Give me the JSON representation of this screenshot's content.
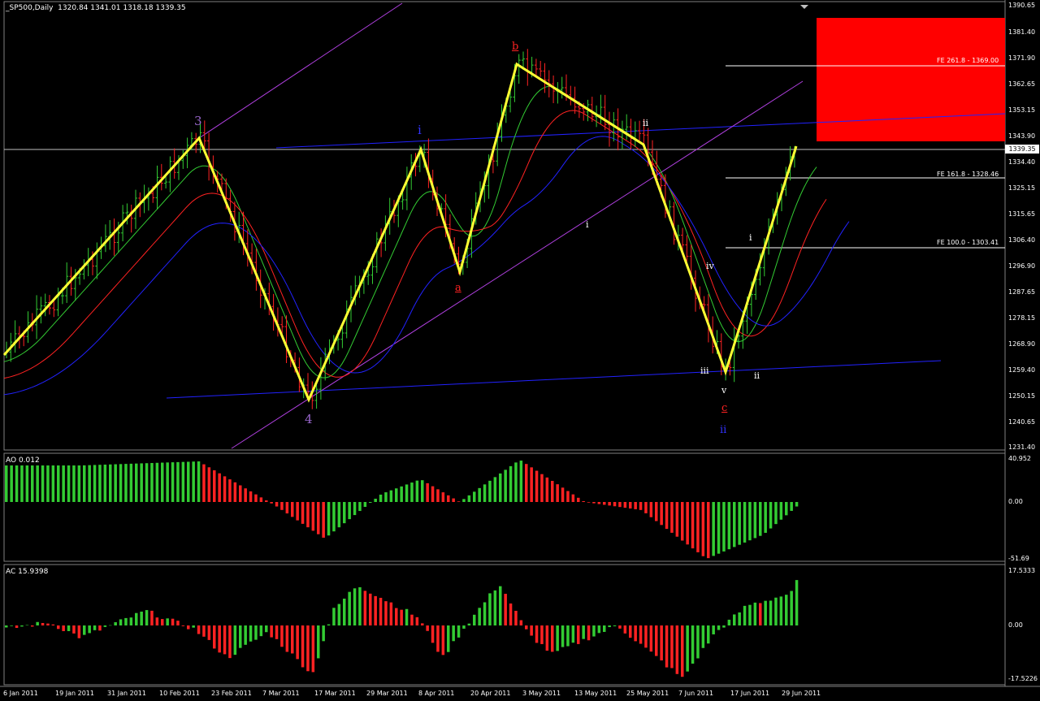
{
  "header": {
    "symbol_line": "_SP500,Daily  1320.84 1341.01 1318.18 1339.35"
  },
  "price_scale": [
    "1390.65",
    "1381.40",
    "1371.90",
    "1362.65",
    "1353.15",
    "1343.90",
    "1334.40",
    "1325.15",
    "1315.65",
    "1306.40",
    "1296.90",
    "1287.65",
    "1278.15",
    "1268.90",
    "1259.40",
    "1250.15",
    "1240.65",
    "1231.40"
  ],
  "last_price": "1339.35",
  "fe_levels": [
    {
      "label": "FE 261.8 - 1369.00"
    },
    {
      "label": "FE 161.8 - 1328.46"
    },
    {
      "label": "FE 100.0 - 1303.41"
    }
  ],
  "wave_labels": [
    {
      "text": "3",
      "color": "#9966cc"
    },
    {
      "text": "4",
      "color": "#9966cc"
    },
    {
      "text": "i",
      "color": "#3333ff"
    },
    {
      "text": "a",
      "color": "#ff2222"
    },
    {
      "text": "b",
      "color": "#ff2222"
    },
    {
      "text": "ii",
      "color": "#ffffff"
    },
    {
      "text": "i",
      "color": "#ffffff"
    },
    {
      "text": "iv",
      "color": "#ffffff"
    },
    {
      "text": "i",
      "color": "#ffffff"
    },
    {
      "text": "iii",
      "color": "#ffffff"
    },
    {
      "text": "ii",
      "color": "#ffffff"
    },
    {
      "text": "v",
      "color": "#ffffff"
    },
    {
      "text": "c",
      "color": "#ff2222"
    },
    {
      "text": "ii",
      "color": "#3333ff"
    }
  ],
  "ao_pane": {
    "title": "AO 0.012",
    "scale": [
      "40.952",
      "0.00",
      "-51.69"
    ]
  },
  "ac_pane": {
    "title": "AC 15.9398",
    "scale": [
      "17.5333",
      "0.00",
      "-17.5226"
    ]
  },
  "dates": [
    "6 Jan 2011",
    "19 Jan 2011",
    "31 Jan 2011",
    "10 Feb 2011",
    "23 Feb 2011",
    "7 Mar 2011",
    "17 Mar 2011",
    "29 Mar 2011",
    "8 Apr 2011",
    "20 Apr 2011",
    "3 May 2011",
    "13 May 2011",
    "25 May 2011",
    "7 Jun 2011",
    "17 Jun 2011",
    "29 Jun 2011"
  ],
  "colors": {
    "background": "#000000",
    "bull_bar": "#33cc33",
    "bear_bar": "#ff2222",
    "zigzag": "#ffff33",
    "trend_blue": "#2222ff",
    "trend_violet": "#b040e0",
    "target_zone": "#ff0000"
  }
}
